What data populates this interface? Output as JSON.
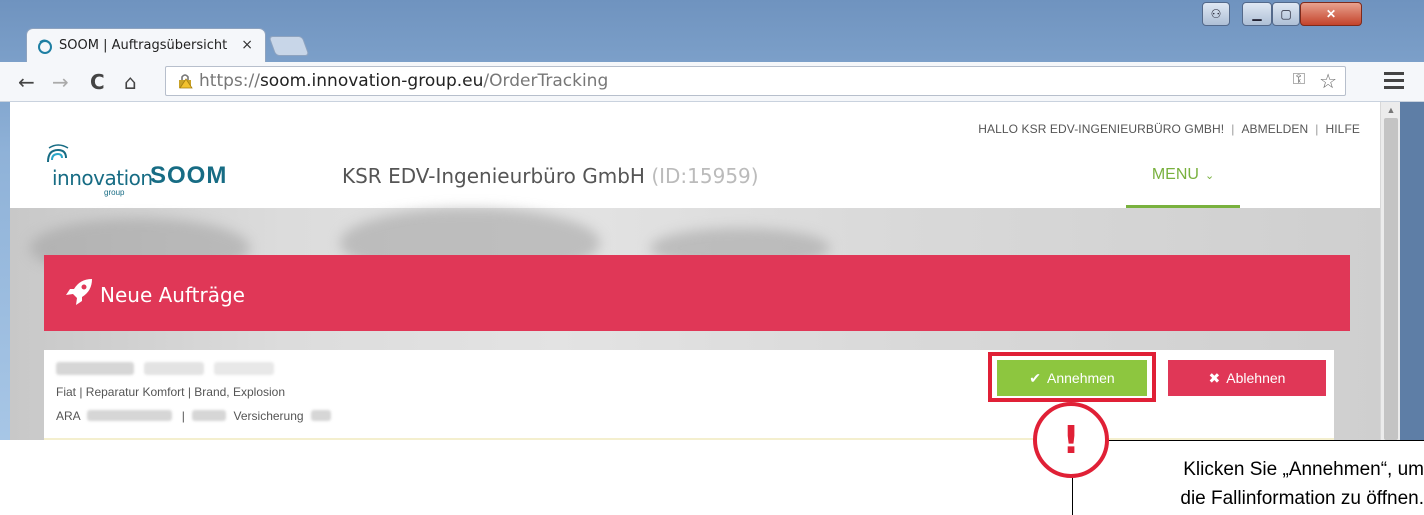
{
  "browser": {
    "tab_title": "SOOM | Auftragsübersicht",
    "tab_close": "×",
    "url_scheme": "https://",
    "url_host": "soom.innovation-group.eu",
    "url_path": "/OrderTracking",
    "window_buttons": {
      "user": "⚇",
      "minimize": "▁",
      "maximize": "▢",
      "close": "✕"
    },
    "nav": {
      "back": "←",
      "forward": "→",
      "reload": "C",
      "home": "⌂"
    }
  },
  "site": {
    "top_nav": {
      "greeting": "HALLO KSR EDV-INGENIEURBÜRO GMBH!",
      "separator": "|",
      "logout": "ABMELDEN",
      "help": "HILFE"
    },
    "logo": {
      "word": "innovation",
      "sub": "group"
    },
    "brand": "SOOM",
    "company_name": "KSR EDV-Ingenieurbüro GmbH",
    "company_id": "(ID:15959)",
    "menu_label": "MENU",
    "menu_chevron": "⌄"
  },
  "panel": {
    "title": "Neue Aufträge"
  },
  "order": {
    "details": "Fiat | Reparatur Komfort | Brand, Explosion",
    "ara_prefix": "ARA",
    "pipe": "|",
    "insurance": "Versicherung",
    "accept_label": "Annehmen",
    "accept_icon": "✔",
    "decline_label": "Ablehnen",
    "decline_icon": "✖"
  },
  "callout": {
    "mark": "!",
    "line1": "Klicken Sie „Annehmen“, um",
    "line2": "die Fallinformation zu öffnen."
  },
  "colors": {
    "brand_teal": "#176c84",
    "menu_green": "#79b13e",
    "panel_red": "#e03757",
    "accept_green": "#8dc63f",
    "highlight_red": "#e02036"
  }
}
